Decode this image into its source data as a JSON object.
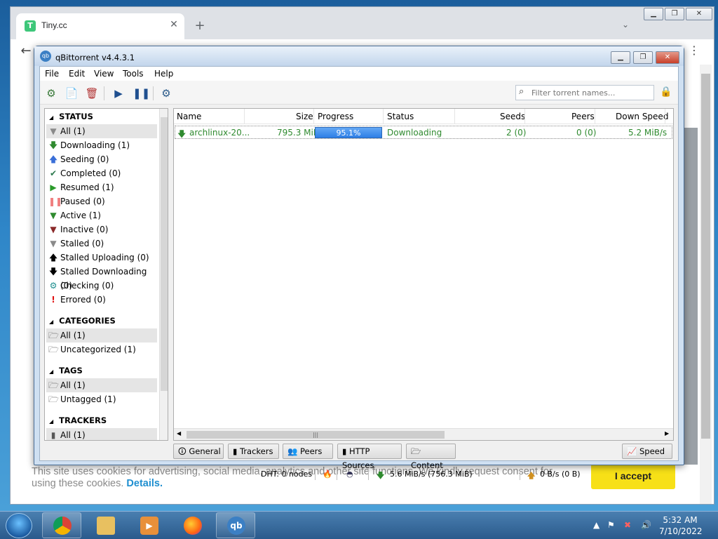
{
  "browser": {
    "tab_title": "Tiny.cc",
    "tab_favicon_letter": "T",
    "tab_close": "✕",
    "new_tab": "+",
    "back": "←",
    "menu": "⋮",
    "tab_search": "⌄"
  },
  "cookie_banner": {
    "text": "This site uses cookies for advertising, social media, analytics and other site functions. We kindly request consent for using these cookies. ",
    "link": "Details.",
    "accept": "I accept"
  },
  "qb": {
    "title": "qBittorrent v4.4.3.1",
    "icon_text": "qb",
    "menu": [
      "File",
      "Edit",
      "View",
      "Tools",
      "Help"
    ],
    "filter_placeholder": "Filter torrent names...",
    "status_header": "STATUS",
    "status_items": [
      {
        "label": "All (1)",
        "icon": "filter-icon",
        "color": "#8a8a8a"
      },
      {
        "label": "Downloading (1)",
        "icon": "down-arrow-icon",
        "color": "#2f8a2f"
      },
      {
        "label": "Seeding (0)",
        "icon": "up-arrow-icon",
        "color": "#3a6fd8"
      },
      {
        "label": "Completed (0)",
        "icon": "checkmark-icon",
        "color": "#2f7a4f"
      },
      {
        "label": "Resumed (1)",
        "icon": "play-icon",
        "color": "#2a9a2a"
      },
      {
        "label": "Paused (0)",
        "icon": "pause-icon",
        "color": "#f08080"
      },
      {
        "label": "Active (1)",
        "icon": "filter-icon",
        "color": "#2f8a2f"
      },
      {
        "label": "Inactive (0)",
        "icon": "filter-icon",
        "color": "#8a2a2a"
      },
      {
        "label": "Stalled (0)",
        "icon": "filter-icon",
        "color": "#8a8a8a"
      },
      {
        "label": "Stalled Uploading (0)",
        "icon": "up-arrow-icon",
        "color": "#000000"
      },
      {
        "label": "Stalled Downloading (0)",
        "icon": "down-arrow-icon",
        "color": "#000000"
      },
      {
        "label": "Checking (0)",
        "icon": "gear-icon",
        "color": "#1f8f8f"
      },
      {
        "label": "Errored (0)",
        "icon": "exclamation-icon",
        "color": "#e01010"
      }
    ],
    "categories_header": "CATEGORIES",
    "categories": [
      "All (1)",
      "Uncategorized (1)"
    ],
    "tags_header": "TAGS",
    "tags": [
      "All (1)",
      "Untagged (1)"
    ],
    "trackers_header": "TRACKERS",
    "trackers": [
      "All (1)"
    ],
    "columns": {
      "name": "Name",
      "size": "Size",
      "progress": "Progress",
      "status": "Status",
      "seeds": "Seeds",
      "peers": "Peers",
      "down_speed": "Down Speed"
    },
    "torrent": {
      "name": "archlinux-20...",
      "size": "795.3 MiB",
      "progress": 0.951,
      "progress_text": "95.1%",
      "status": "Downloading",
      "seeds": "2 (0)",
      "peers": "0 (0)",
      "down_speed": "5.2 MiB/s"
    },
    "bottom_tabs": [
      "General",
      "Trackers",
      "Peers",
      "HTTP Sources",
      "Content"
    ],
    "speed_button": "Speed",
    "statusbar": {
      "dht": "DHT: 0 nodes",
      "download": "5.6 MiB/s (756.3 MiB)",
      "upload": "0 B/s (0 B)"
    }
  },
  "taskbar": {
    "time": "5:32 AM",
    "date": "7/10/2022",
    "qb_label": "qb"
  }
}
